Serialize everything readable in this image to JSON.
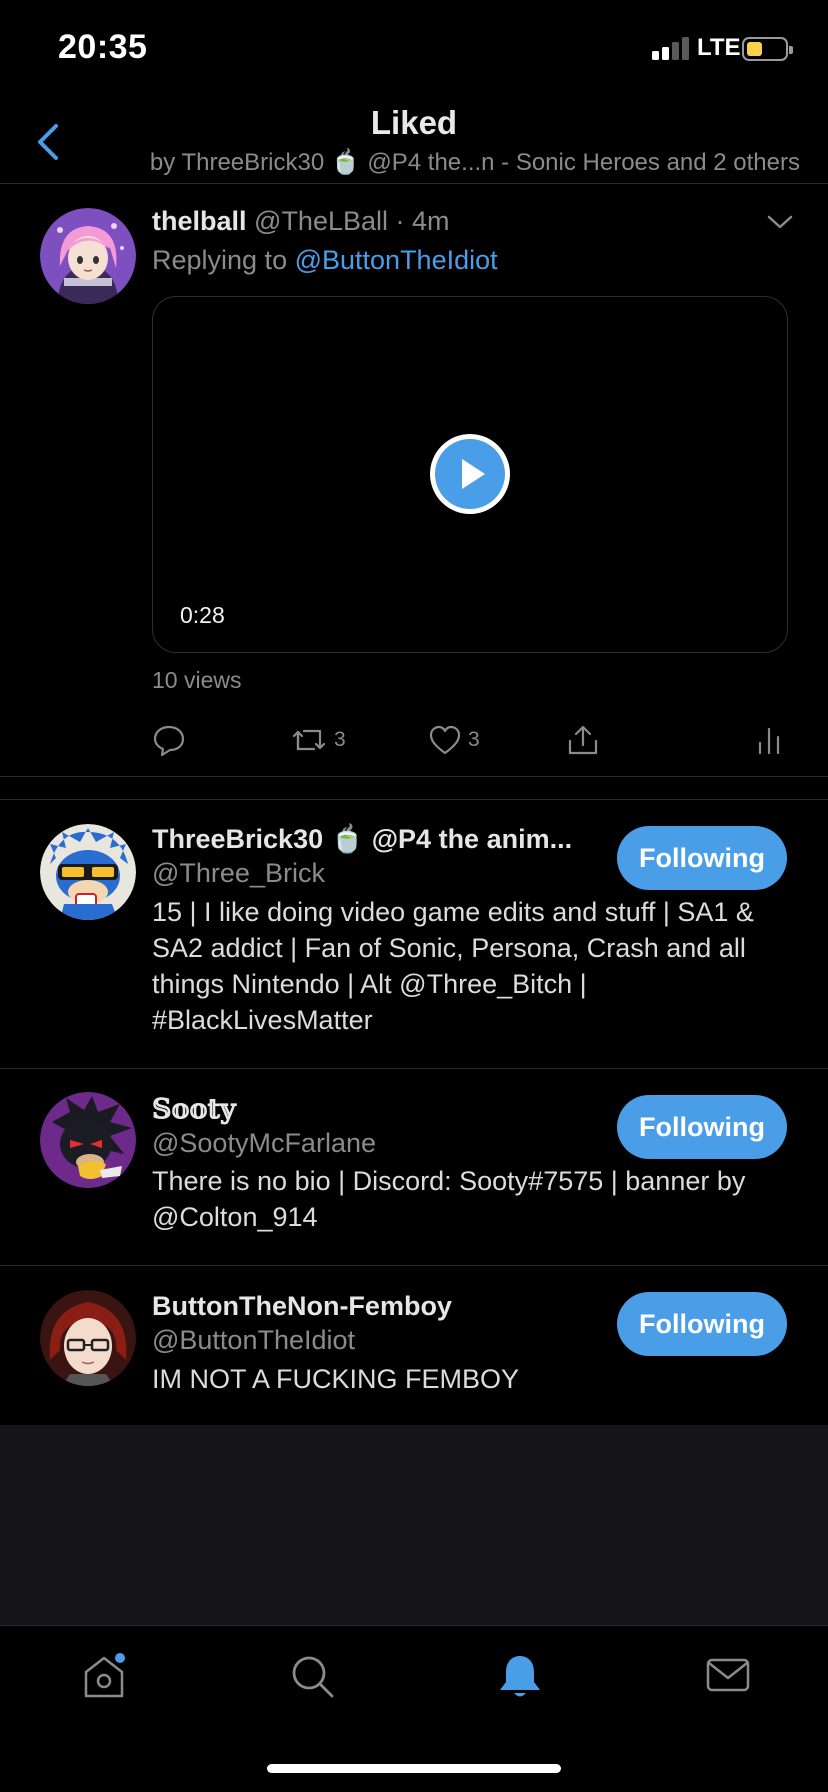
{
  "status_bar": {
    "time": "20:35",
    "network": "LTE"
  },
  "header": {
    "title": "Liked",
    "subtitle": "by ThreeBrick30 🍵 @P4 the...n - Sonic Heroes and 2 others",
    "back_icon": "chevron-left-icon"
  },
  "tweet": {
    "display_name": "thelball",
    "handle_time": "@TheLBall · 4m",
    "reply_prefix": "Replying to ",
    "reply_to": "@ButtonTheIdiot",
    "video_duration": "0:28",
    "views": "10 views",
    "actions": {
      "reply_icon": "reply-icon",
      "retweet_icon": "retweet-icon",
      "retweet_count": "3",
      "like_icon": "heart-icon",
      "like_count": "3",
      "share_icon": "share-icon",
      "analytics_icon": "analytics-icon"
    }
  },
  "users": [
    {
      "display_name": "ThreeBrick30 🍵 @P4 the anim...",
      "handle": "@Three_Brick",
      "bio": "15 | I like doing video game edits and stuff | SA1 & SA2 addict | Fan of Sonic, Persona, Crash and all things Nintendo | Alt @Three_Bitch | #BlackLivesMatter",
      "button": "Following"
    },
    {
      "display_name": "𝕊𝕠𝕠𝕥𝕪",
      "handle": "@SootyMcFarlane",
      "bio": "There is no bio | Discord: Sooty#7575 | banner by @Colton_914",
      "button": "Following"
    },
    {
      "display_name": "ButtonTheNon-Femboy",
      "handle": "@ButtonTheIdiot",
      "bio": "IM NOT A FUCKING FEMBOY",
      "button": "Following"
    }
  ],
  "tab_bar": {
    "items": [
      "home-icon",
      "search-icon",
      "notifications-icon",
      "messages-icon"
    ],
    "active": "notifications-icon"
  },
  "colors": {
    "accent": "#4a9ee8",
    "background": "#000000",
    "muted_text": "#8b8b8b",
    "primary_text": "#e6e6e6",
    "battery": "#f7d24a"
  }
}
